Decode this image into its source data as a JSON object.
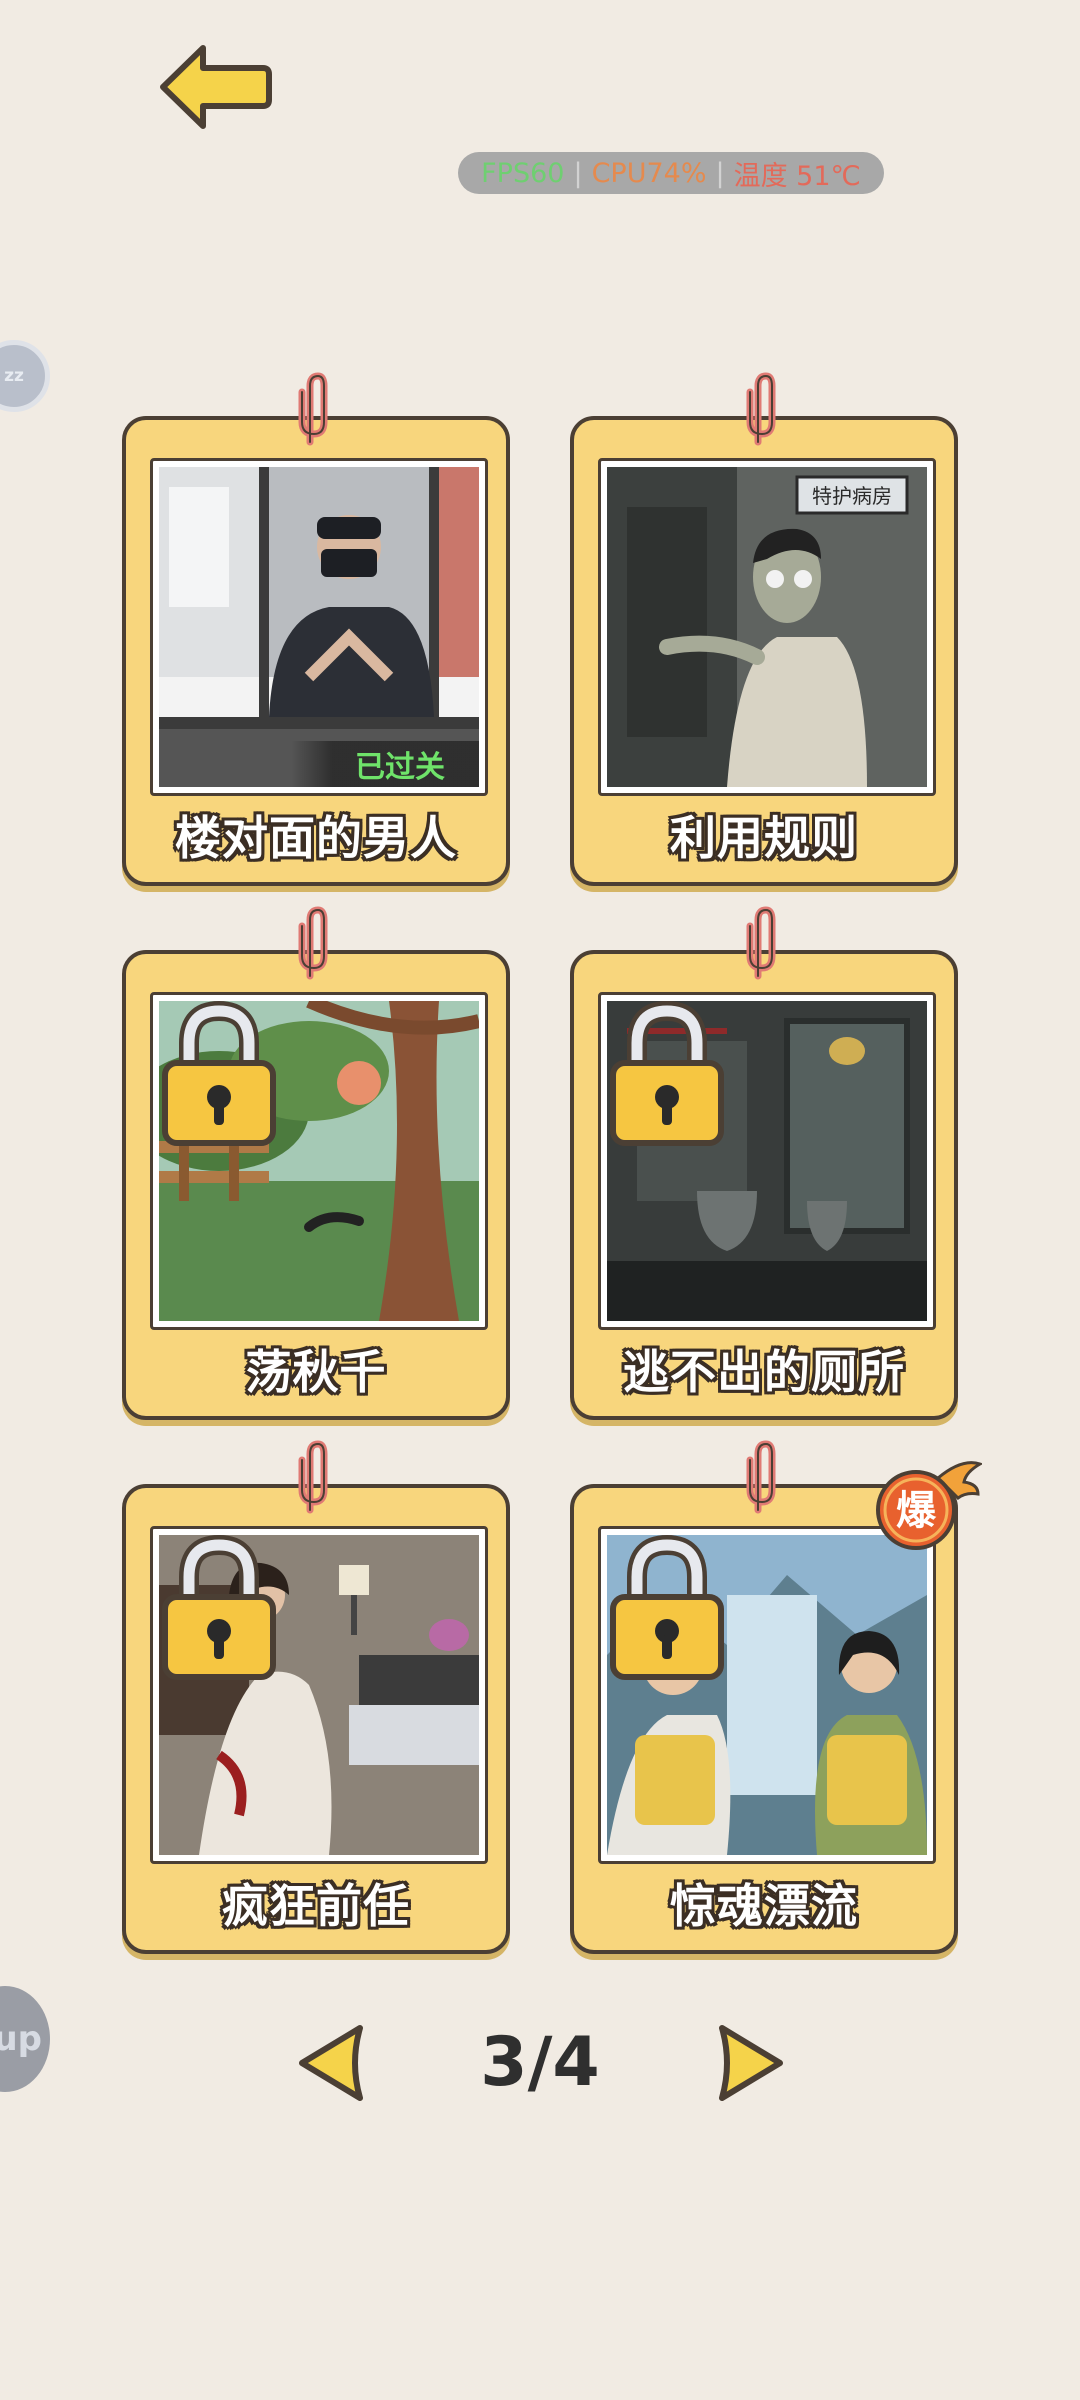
{
  "perf": {
    "fps": "FPS60",
    "cpu": "CPU74%",
    "temp": "温度 51℃"
  },
  "float_top_label": "zz",
  "float_bottom_label": "up",
  "levels": [
    {
      "title": "楼对面的男人",
      "status": "已过关",
      "locked": false
    },
    {
      "title": "利用规则",
      "sign": "特护病房",
      "locked": false
    },
    {
      "title": "荡秋千",
      "locked": true
    },
    {
      "title": "逃不出的厕所",
      "locked": true
    },
    {
      "title": "疯狂前任",
      "locked": true
    },
    {
      "title": "惊魂漂流",
      "badge": "爆",
      "locked": true
    }
  ],
  "pager": {
    "current": "3/4"
  },
  "colors": {
    "card": "#f8d67d",
    "arrow": "#f5d34a",
    "background": "#f1ebe3"
  }
}
